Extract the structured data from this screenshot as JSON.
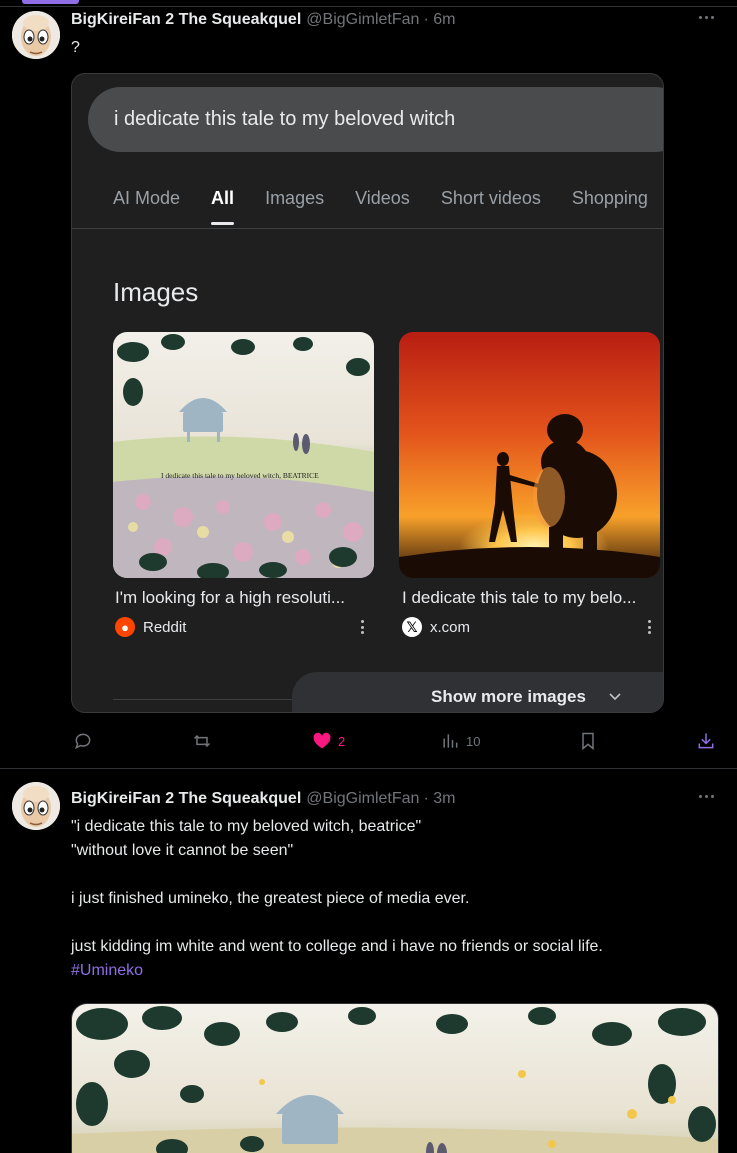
{
  "posts": [
    {
      "display_name": "BigKireiFan 2 The Squeakquel",
      "handle": "@BigGimletFan",
      "time": "· 6m",
      "text_lines": [
        "?"
      ],
      "embedded_screenshot": {
        "search_query": "i dedicate this tale to my beloved witch",
        "tabs": [
          "AI Mode",
          "All",
          "Images",
          "Videos",
          "Short videos",
          "Shopping"
        ],
        "active_tab": "All",
        "section_title": "Images",
        "results": [
          {
            "title": "I'm looking for a high resoluti...",
            "source": "Reddit",
            "source_icon": "reddit-icon",
            "image_caption": "I dedicate this tale to my beloved witch, BEATRICE"
          },
          {
            "title": "I dedicate this tale to my belo...",
            "source": "x.com",
            "source_icon": "x-icon"
          }
        ],
        "show_more_label": "Show more images"
      },
      "actions": {
        "reply_count": "",
        "repost_count": "",
        "like_count": "2",
        "view_count": "10",
        "liked": true
      }
    },
    {
      "display_name": "BigKireiFan 2 The Squeakquel",
      "handle": "@BigGimletFan",
      "time": "· 3m",
      "text_lines": [
        "\"i dedicate this tale to my beloved witch, beatrice\"",
        "\"without love it cannot be seen\"",
        "",
        "i just finished umineko, the greatest piece of media ever.",
        "",
        "just kidding im white and went to college and i have no friends or social life."
      ],
      "hashtag": "#Umineko"
    }
  ],
  "colors": {
    "background": "#000000",
    "text": "#e7e9ea",
    "muted": "#71767b",
    "accent": "#8f6ee6",
    "like": "#f91880"
  }
}
